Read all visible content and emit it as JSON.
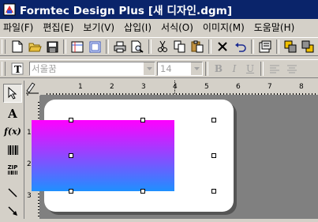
{
  "window": {
    "title": "Formtec Design Plus [새 디자인.dgm]"
  },
  "menu": {
    "items": [
      "파일(F)",
      "편집(E)",
      "보기(V)",
      "삽입(I)",
      "서식(O)",
      "이미지(M)",
      "도움말(H)"
    ]
  },
  "toolbar": {
    "buttons": [
      "new-icon",
      "open-icon",
      "save-icon",
      "page-setup-icon",
      "grid-icon",
      "print-icon",
      "print-preview-icon",
      "cut-icon",
      "copy-icon",
      "paste-icon",
      "delete-icon",
      "undo-icon",
      "properties-icon",
      "bring-front-icon",
      "send-back-icon"
    ]
  },
  "format_toolbar": {
    "font_name": "서울꿈",
    "font_size": "14",
    "bold": "B",
    "italic": "I",
    "underline": "U"
  },
  "tools": {
    "text_label": "A",
    "function_label": "f(x)",
    "barcode_label": "ZIP"
  },
  "rulers": {
    "horizontal_labels": [
      "1",
      "2",
      "3",
      "4",
      "5",
      "6",
      "7",
      "8"
    ],
    "vertical_labels": [
      "1",
      "2",
      "3"
    ]
  },
  "shape": {
    "gradient_top": "#ff00ff",
    "gradient_bottom": "#1e90ff",
    "selected": true
  },
  "colors": {
    "title_bar": "#0a246a",
    "face": "#d4d0c8",
    "canvas_bg": "#808080"
  }
}
